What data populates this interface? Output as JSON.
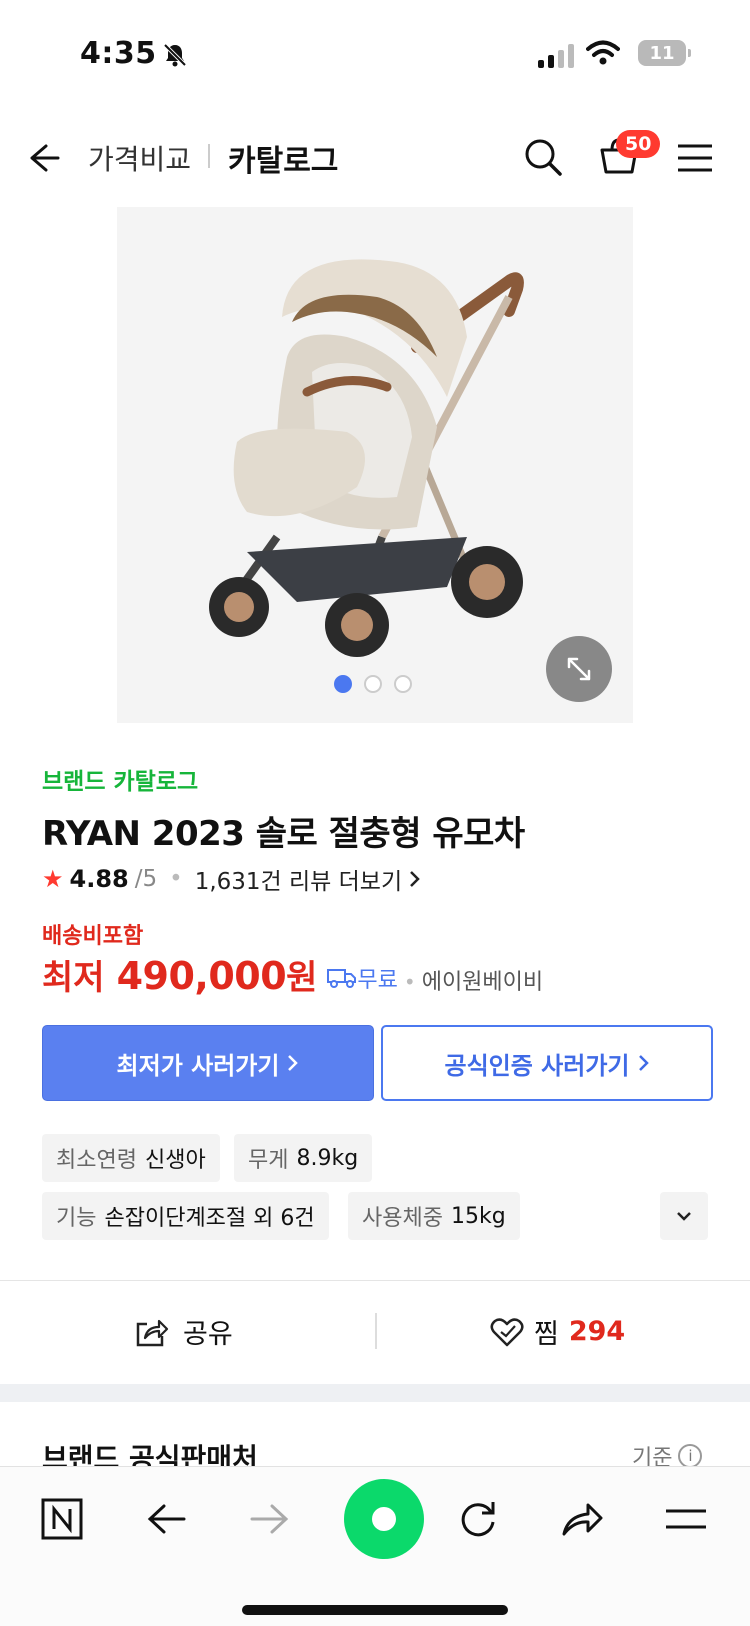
{
  "status": {
    "time": "4:35",
    "battery": "11"
  },
  "nav": {
    "crumb1": "가격비교",
    "crumb2": "카탈로그",
    "cart_count": "50"
  },
  "product": {
    "brand": "브랜드 카탈로그",
    "title": "RYAN 2023 솔로 절충형 유모차",
    "rating": "4.88",
    "rating_max": "/5",
    "reviews": "1,631건 리뷰 더보기",
    "shipping_note": "배송비포함",
    "price_label": "최저",
    "price": "490,000",
    "price_unit": "원",
    "delivery": "무료",
    "seller": "에이원베이비",
    "image_count": 3
  },
  "buttons": {
    "lowest": "최저가 사러가기",
    "official": "공식인증 사러가기"
  },
  "specs": [
    {
      "key": "최소연령",
      "value": "신생아"
    },
    {
      "key": "무게",
      "value": "8.9kg"
    },
    {
      "key": "기능",
      "value": "손잡이단계조절 외 6건"
    },
    {
      "key": "사용체중",
      "value": "15kg"
    }
  ],
  "actions": {
    "share": "공유",
    "wish": "찜",
    "wish_count": "294"
  },
  "section": {
    "title": "브랜드 공식판매처",
    "right": "기준"
  },
  "colors": {
    "accent_blue": "#4b78f0",
    "price_red": "#e0291d",
    "brand_green": "#16b53a",
    "naver_green": "#0bd96b"
  }
}
